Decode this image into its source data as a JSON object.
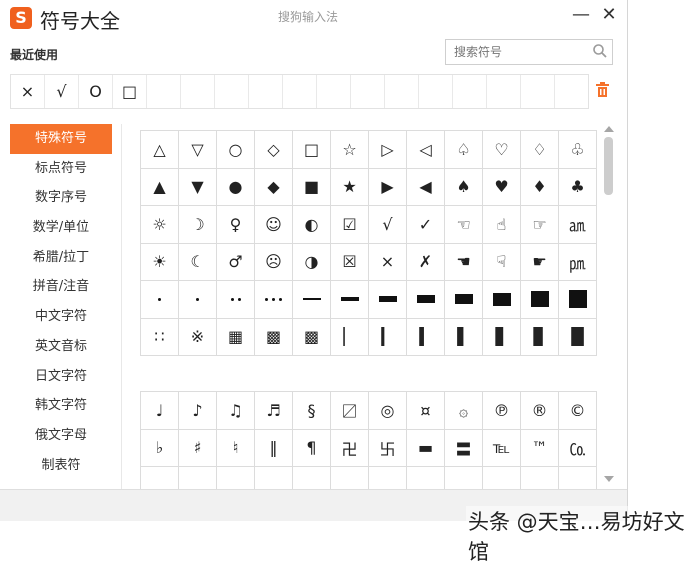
{
  "window": {
    "app_title": "符号大全",
    "center_title": "搜狗输入法",
    "logo_letter": "S",
    "accent": "#f5722b"
  },
  "recent": {
    "label": "最近使用",
    "items": [
      "×",
      "√",
      "O",
      "□",
      "",
      "",
      "",
      "",
      "",
      "",
      "",
      "",
      "",
      "",
      "",
      "",
      ""
    ]
  },
  "search": {
    "placeholder": "搜索符号"
  },
  "sidebar": [
    {
      "label": "特殊符号",
      "active": true
    },
    {
      "label": "标点符号"
    },
    {
      "label": "数字序号"
    },
    {
      "label": "数学/单位"
    },
    {
      "label": "希腊/拉丁"
    },
    {
      "label": "拼音/注音"
    },
    {
      "label": "中文字符"
    },
    {
      "label": "英文音标"
    },
    {
      "label": "日文字符"
    },
    {
      "label": "韩文字符"
    },
    {
      "label": "俄文字母"
    },
    {
      "label": "制表符"
    }
  ],
  "grid1": [
    [
      "△",
      "▽",
      "○",
      "◇",
      "□",
      "☆",
      "▷",
      "◁",
      "♤",
      "♡",
      "♢",
      "♧"
    ],
    [
      "▲",
      "▼",
      "●",
      "◆",
      "■",
      "★",
      "▶",
      "◀",
      "♠",
      "♥",
      "♦",
      "♣"
    ],
    [
      "☼",
      "☽",
      "♀",
      "☺",
      "◐",
      "☑",
      "√",
      "✓",
      "☜",
      "☝",
      "☞",
      "㏂"
    ],
    [
      "☀",
      "☾",
      "♂",
      "☹",
      "◑",
      "☒",
      "×",
      "✗",
      "☚",
      "☟",
      "☛",
      "㏘"
    ],
    [
      "dot1",
      "dot2",
      "dot3",
      "dot4",
      "bar1",
      "bar2",
      "bar3",
      "bar4",
      "bar5",
      "bar6",
      "bar7",
      "bar8"
    ],
    [
      "∷",
      "※",
      "▦",
      "▩",
      "▩",
      "▏",
      "▎",
      "▍",
      "▌",
      "▋",
      "▊",
      "█"
    ]
  ],
  "grid2": [
    [
      "♩",
      "♪",
      "♫",
      "♬",
      "§",
      "〼",
      "◎",
      "¤",
      "۞",
      "℗",
      "®",
      "©"
    ],
    [
      "♭",
      "♯",
      "♮",
      "‖",
      "¶",
      "卍",
      "卐",
      "▬",
      "〓",
      "℡",
      "™",
      "㏇"
    ],
    [
      "",
      "",
      "",
      "",
      "",
      "",
      "",
      "",
      "",
      "",
      "",
      ""
    ]
  ],
  "watermark": "头条 @天宝…易坊好文馆"
}
